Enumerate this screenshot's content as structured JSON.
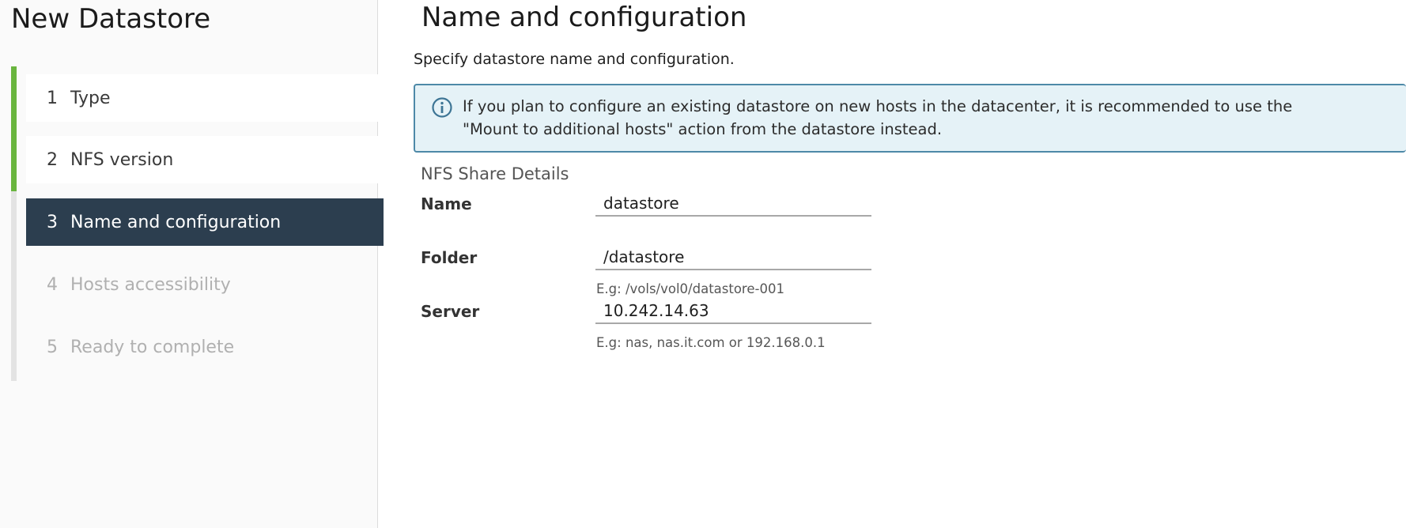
{
  "wizard": {
    "title": "New Datastore"
  },
  "steps": [
    {
      "number": "1",
      "label": "Type",
      "state": "completed"
    },
    {
      "number": "2",
      "label": "NFS version",
      "state": "completed"
    },
    {
      "number": "3",
      "label": "Name and configuration",
      "state": "active"
    },
    {
      "number": "4",
      "label": "Hosts accessibility",
      "state": "disabled"
    },
    {
      "number": "5",
      "label": "Ready to complete",
      "state": "disabled"
    }
  ],
  "page": {
    "title": "Name and configuration",
    "subtitle": "Specify datastore name and configuration."
  },
  "alert": {
    "icon": "info-icon",
    "text": "If you plan to configure an existing datastore on new hosts in the datacenter, it is recommended to use the \"Mount to additional hosts\" action from the datastore instead.",
    "close_icon": "close-icon"
  },
  "section": {
    "title": "NFS Share Details"
  },
  "fields": {
    "name": {
      "label": "Name",
      "value": "datastore"
    },
    "folder": {
      "label": "Folder",
      "value": "/datastore",
      "helper": "E.g: /vols/vol0/datastore-001"
    },
    "server": {
      "label": "Server",
      "value": "10.242.14.63",
      "helper": "E.g: nas, nas.it.com or 192.168.0.1"
    }
  },
  "colors": {
    "completed_bar": "#69b53e",
    "active_step_bg": "#2c3e4f",
    "alert_bg": "#e5f2f7",
    "alert_border": "#4d89a8"
  }
}
